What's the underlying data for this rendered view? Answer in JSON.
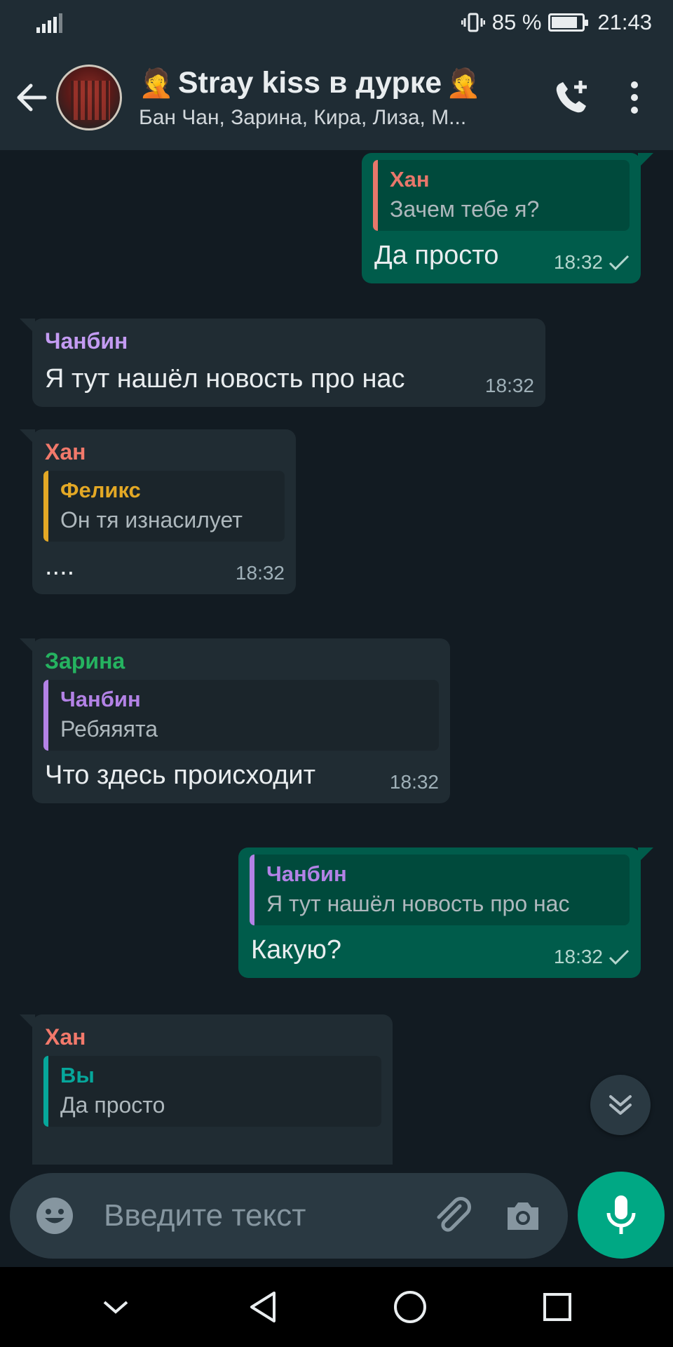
{
  "status_bar": {
    "battery_percent": "85 %",
    "time": "21:43",
    "battery_level": 0.85
  },
  "header": {
    "title": "Stray kiss в дурке",
    "title_emoji": "🤦",
    "subtitle": "Бан Чан, Зарина, Кира, Лиза, М..."
  },
  "messages": [
    {
      "direction": "out",
      "quote": {
        "author": "Хан",
        "text": "Зачем тебе я?",
        "color": "#e8776b"
      },
      "text": "Да просто",
      "time": "18:32",
      "status": "sent"
    },
    {
      "direction": "in",
      "sender": {
        "name": "Чанбин",
        "color": "#c39bf2"
      },
      "text": "Я тут нашёл новость про нас",
      "time": "18:32"
    },
    {
      "direction": "in",
      "sender": {
        "name": "Хан",
        "color": "#f2796b"
      },
      "quote": {
        "author": "Феликс",
        "text": "Он тя изнасилует",
        "color": "#e3a825"
      },
      "text": "....",
      "time": "18:32"
    },
    {
      "direction": "in",
      "sender": {
        "name": "Зарина",
        "color": "#25b360"
      },
      "quote": {
        "author": "Чанбин",
        "text": "Ребяяята",
        "color": "#b382e6"
      },
      "text": "Что здесь происходит",
      "time": "18:32"
    },
    {
      "direction": "out",
      "quote": {
        "author": "Чанбин",
        "text": "Я тут нашёл новость про нас",
        "color": "#b382e6"
      },
      "text": "Какую?",
      "time": "18:32",
      "status": "sent"
    },
    {
      "direction": "in",
      "sender": {
        "name": "Хан",
        "color": "#f2796b"
      },
      "quote": {
        "author": "Вы",
        "text": "Да просто",
        "color": "#06a79b"
      }
    }
  ],
  "composer": {
    "placeholder": "Введите текст"
  },
  "icons": {
    "back": "arrow-left-icon",
    "add_call": "phone-plus-icon",
    "menu": "more-vert-icon",
    "emoji": "emoji-icon",
    "attach": "paperclip-icon",
    "camera": "camera-icon",
    "mic": "mic-icon",
    "scroll": "double-chevron-down-icon",
    "nav_down": "chevron-down-icon",
    "nav_back": "triangle-back-icon",
    "nav_home": "circle-home-icon",
    "nav_recent": "square-recent-icon"
  },
  "colors": {
    "accent": "#00a884",
    "outgoing_bubble": "#005c4b",
    "incoming_bubble": "#202c33",
    "background": "#121b22"
  }
}
